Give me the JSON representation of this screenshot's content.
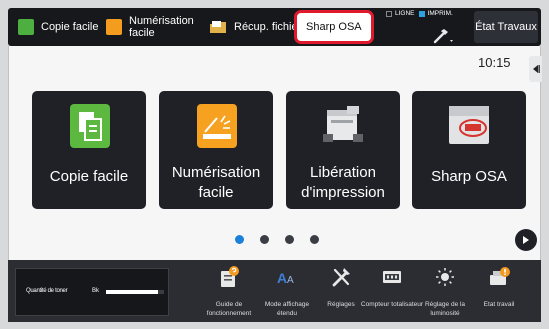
{
  "topbar": {
    "shortcuts": [
      {
        "label": "Copie facile",
        "icon": "copy-icon"
      },
      {
        "label": "Numérisation facile",
        "icon": "scan-icon"
      },
      {
        "label": "Récup. fichier",
        "icon": "folder-icon"
      },
      {
        "label": "Sharp OSA",
        "icon": "none"
      }
    ],
    "status": {
      "line_label": "LIGNE",
      "print_label": "IMPRIM."
    },
    "jobs_button": "État Travaux"
  },
  "main": {
    "time": "10:15",
    "tiles": [
      {
        "label": "Copie facile",
        "icon": "copy-icon"
      },
      {
        "label": "Numérisation facile",
        "icon": "scan-icon"
      },
      {
        "label": "Libération d'impression",
        "icon": "printer-icon"
      },
      {
        "label": "Sharp OSA",
        "icon": "osa-icon"
      }
    ],
    "pagination": {
      "pages": 4,
      "current": 1
    }
  },
  "bottombar": {
    "toner": {
      "label": "Quantité de toner",
      "color": "Bk",
      "level": 0.9
    },
    "items": [
      {
        "label": "Guide de fonctionnement",
        "icon": "guide-icon"
      },
      {
        "label": "Mode affichage étendu",
        "icon": "text-size-icon"
      },
      {
        "label": "Réglages",
        "icon": "tools-icon"
      },
      {
        "label": "Compteur totalisateur",
        "icon": "counter-icon"
      },
      {
        "label": "Réglage de la luminosité",
        "icon": "brightness-icon"
      },
      {
        "label": "Etat travail",
        "icon": "job-status-icon"
      }
    ]
  },
  "colors": {
    "highlight": "#e0192d",
    "accent": "#1b80d8",
    "copy": "#4caf3f",
    "scan": "#f39c1e"
  }
}
